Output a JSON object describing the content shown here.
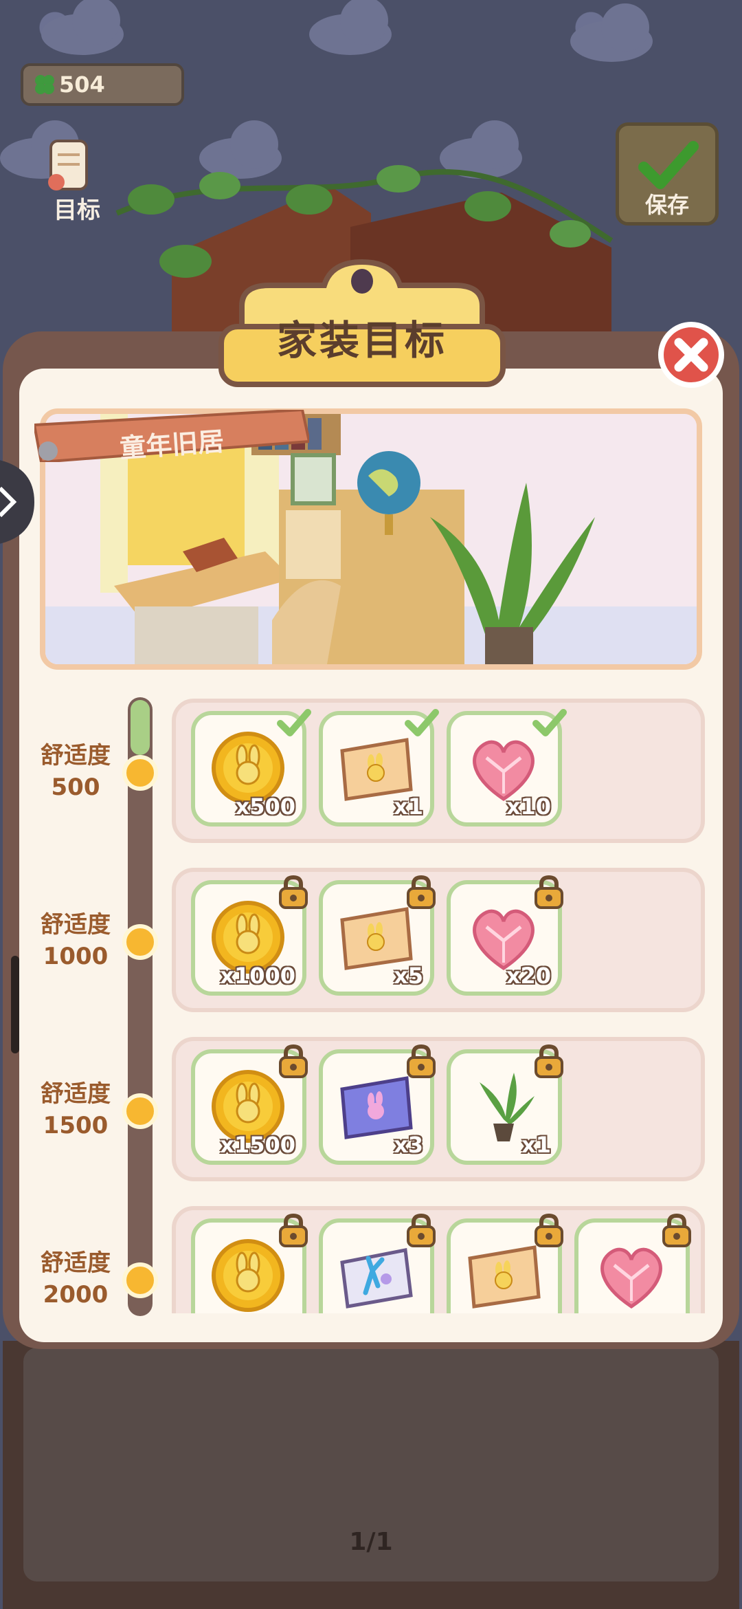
{
  "hud": {
    "clover_count": "504",
    "goal_label": "目标",
    "save_label": "保存"
  },
  "dialog": {
    "title": "家装目标",
    "scene_name": "童年旧居"
  },
  "tiers": [
    {
      "label": "舒适度",
      "value": "500",
      "rewards": [
        {
          "icon": "bunny-coin-icon",
          "qty": "x500",
          "status": "claimed"
        },
        {
          "icon": "bunny-ticket-icon",
          "qty": "x1",
          "status": "claimed"
        },
        {
          "icon": "crystal-heart-icon",
          "qty": "x10",
          "status": "claimed"
        }
      ]
    },
    {
      "label": "舒适度",
      "value": "1000",
      "rewards": [
        {
          "icon": "bunny-coin-icon",
          "qty": "x1000",
          "status": "locked"
        },
        {
          "icon": "bunny-ticket-icon",
          "qty": "x5",
          "status": "locked"
        },
        {
          "icon": "crystal-heart-icon",
          "qty": "x20",
          "status": "locked"
        }
      ]
    },
    {
      "label": "舒适度",
      "value": "1500",
      "rewards": [
        {
          "icon": "bunny-coin-icon",
          "qty": "x1500",
          "status": "locked"
        },
        {
          "icon": "purple-bunny-ticket-icon",
          "qty": "x3",
          "status": "locked"
        },
        {
          "icon": "potted-plant-icon",
          "qty": "x1",
          "status": "locked"
        }
      ]
    },
    {
      "label": "舒适度",
      "value": "2000",
      "rewards": [
        {
          "icon": "bunny-coin-icon",
          "qty": "",
          "status": "locked"
        },
        {
          "icon": "coral-ticket-icon",
          "qty": "",
          "status": "locked"
        },
        {
          "icon": "bunny-ticket-icon",
          "qty": "",
          "status": "locked"
        },
        {
          "icon": "crystal-heart-icon",
          "qty": "",
          "status": "locked"
        }
      ]
    }
  ],
  "pager": {
    "text": "1/1"
  },
  "colors": {
    "accent_green": "#8dc86a",
    "lock_gold": "#e9a93a",
    "panel_brown": "#76574d",
    "title_yellow": "#f8dc7c"
  }
}
